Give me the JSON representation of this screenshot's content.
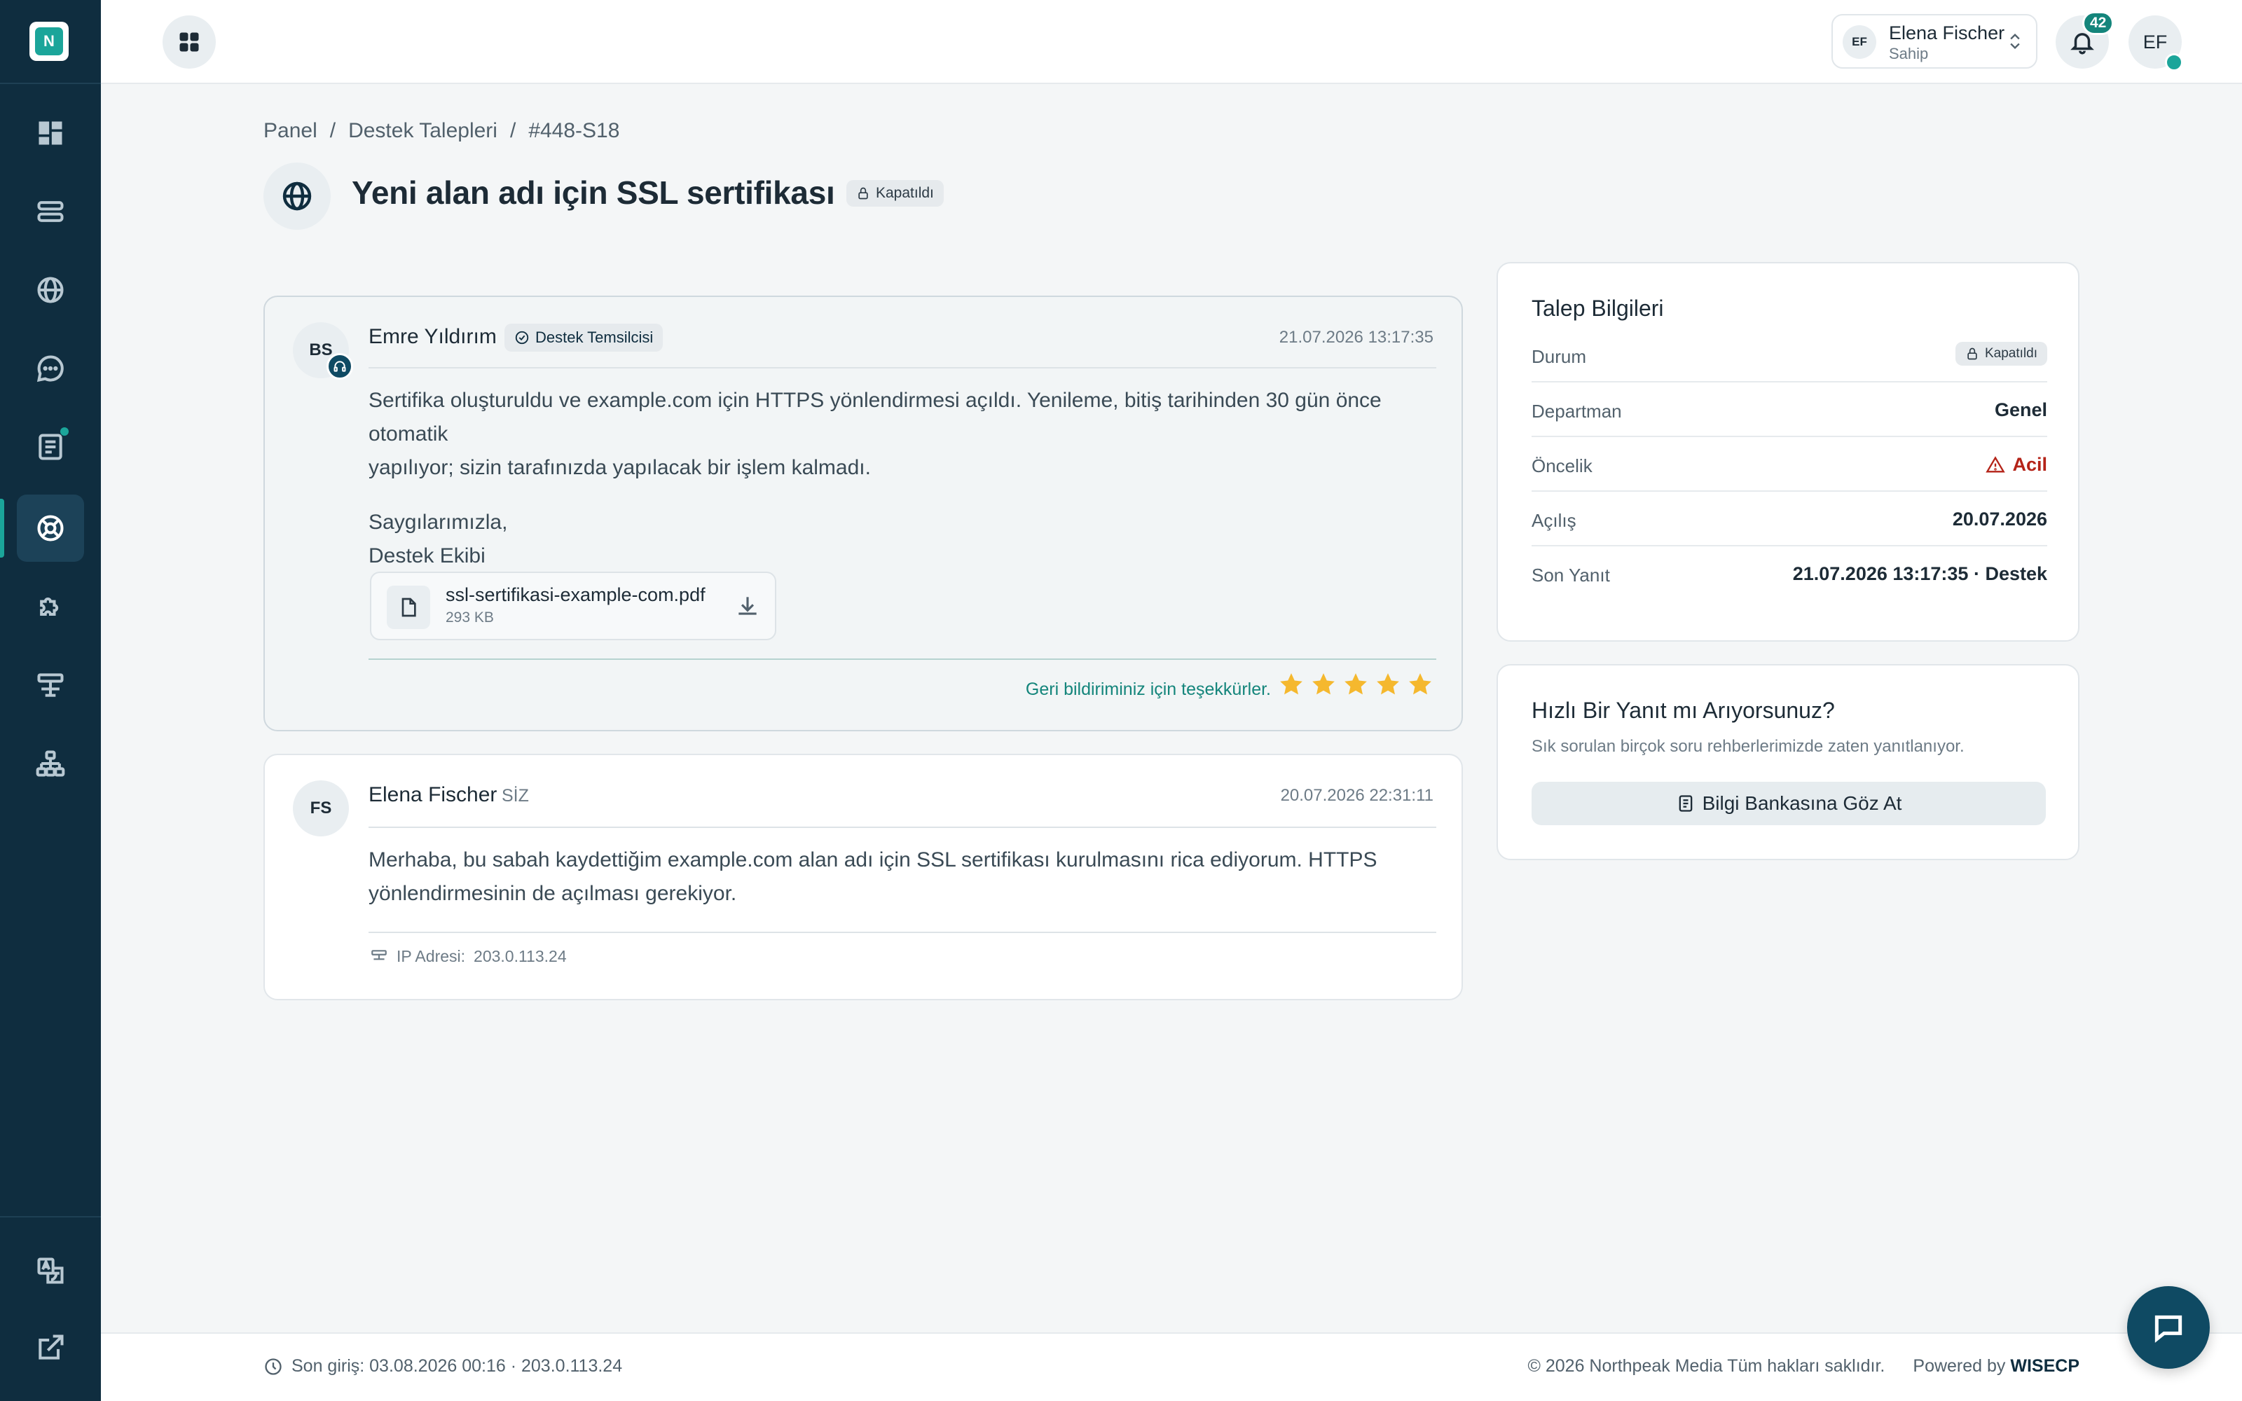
{
  "brand": {
    "logo_letter": "N"
  },
  "header": {
    "account": {
      "initials": "EF",
      "name": "Elena Fischer",
      "role": "Sahip"
    },
    "notifications": {
      "count": "42"
    },
    "user_initials": "EF"
  },
  "breadcrumb": [
    "Panel",
    "Destek Talepleri",
    "#448-S18"
  ],
  "page": {
    "title": "Yeni alan adı için SSL sertifikası",
    "status": "Kapatıldı"
  },
  "messages": [
    {
      "initials": "BS",
      "author": "Emre Yıldırım",
      "role": "Destek Temsilcisi",
      "time": "21.07.2026 13:17:35",
      "body_lines": [
        "Sertifika oluşturuldu ve example.com için HTTPS yönlendirmesi açıldı. Yenileme, bitiş tarihinden 30 gün önce otomatik",
        "yapılıyor; sizin tarafınızda yapılacak bir işlem kalmadı."
      ],
      "signature": [
        "Saygılarımızla,",
        "Destek Ekibi"
      ],
      "attachment": {
        "name": "ssl-sertifikasi-example-com.pdf",
        "size": "293 KB"
      },
      "feedback": "Geri bildiriminiz için teşekkürler.",
      "rating": 5
    },
    {
      "initials": "FS",
      "author": "Elena Fischer",
      "you_label": "SİZ",
      "time": "20.07.2026 22:31:11",
      "body_lines": [
        "Merhaba, bu sabah kaydettiğim example.com alan adı için SSL sertifikası kurulmasını rica ediyorum. HTTPS",
        "yönlendirmesinin de açılması gerekiyor."
      ],
      "ip_label": "IP Adresi:",
      "ip": "203.0.113.24"
    }
  ],
  "ticket_info": {
    "title": "Talep Bilgileri",
    "rows": [
      {
        "label": "Durum",
        "value": "Kapatıldı"
      },
      {
        "label": "Departman",
        "value": "Genel"
      },
      {
        "label": "Öncelik",
        "value": "Acil"
      },
      {
        "label": "Açılış",
        "value": "20.07.2026"
      },
      {
        "label": "Son Yanıt",
        "value": "21.07.2026 13:17:35 · Destek"
      }
    ]
  },
  "quick": {
    "title": "Hızlı Bir Yanıt mı Arıyorsunuz?",
    "subtitle": "Sık sorulan birçok soru rehberlerimizde zaten yanıtlanıyor.",
    "button": "Bilgi Bankasına Göz At"
  },
  "footer": {
    "last_login": "Son giriş: 03.08.2026 00:16 · 203.0.113.24",
    "copyright": "© 2026 Northpeak Media Tüm hakları saklıdır.",
    "powered_prefix": "Powered by",
    "powered_brand": "WISECP"
  },
  "colors": {
    "sidebar": "#0f2d3f",
    "accent": "#1ba59a",
    "star": "#f5b82e",
    "urgent": "#b42318"
  }
}
